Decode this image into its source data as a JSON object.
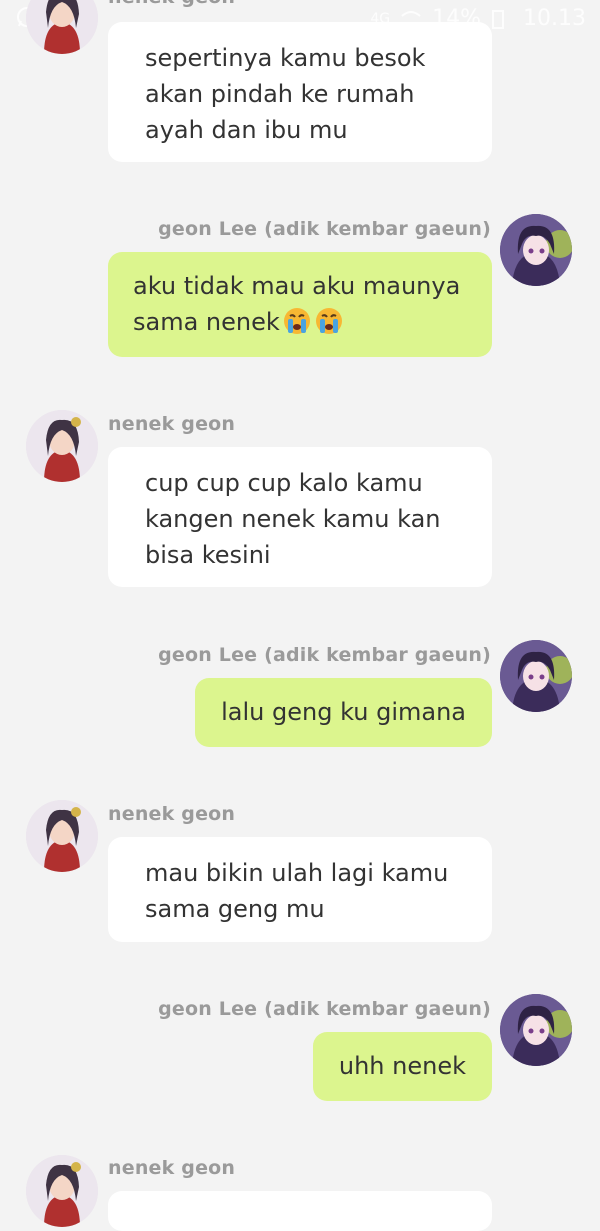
{
  "status_bar": {
    "time": "10.13",
    "battery": "14%",
    "network": "4G"
  },
  "messages": [
    {
      "sender": "nenek geon",
      "side": "left",
      "lines": [
        "sepertinya kamu besok",
        "akan pindah ke rumah",
        "ayah dan ibu mu"
      ]
    },
    {
      "sender": "geon Lee (adik kembar gaeun)",
      "side": "right",
      "lines": [
        "aku tidak mau aku maunya",
        "sama nenek"
      ],
      "trailing_emoji": [
        "loudly-crying-face",
        "loudly-crying-face"
      ]
    },
    {
      "sender": "nenek geon",
      "side": "left",
      "lines": [
        "cup cup cup kalo kamu",
        "kangen nenek kamu kan",
        "bisa kesini"
      ]
    },
    {
      "sender": "geon Lee (adik kembar gaeun)",
      "side": "right",
      "lines": [
        "lalu geng ku gimana"
      ]
    },
    {
      "sender": "nenek geon",
      "side": "left",
      "lines": [
        "mau bikin ulah lagi kamu",
        "sama geng mu"
      ]
    },
    {
      "sender": "geon Lee (adik kembar gaeun)",
      "side": "right",
      "lines": [
        "uhh nenek"
      ]
    },
    {
      "sender": "nenek geon",
      "side": "left",
      "lines": []
    }
  ],
  "colors": {
    "background": "#f3f3f3",
    "incoming_bubble": "#ffffff",
    "outgoing_bubble": "#dcf58e",
    "sender_name": "#9a9a9a",
    "message_text": "#333333"
  }
}
